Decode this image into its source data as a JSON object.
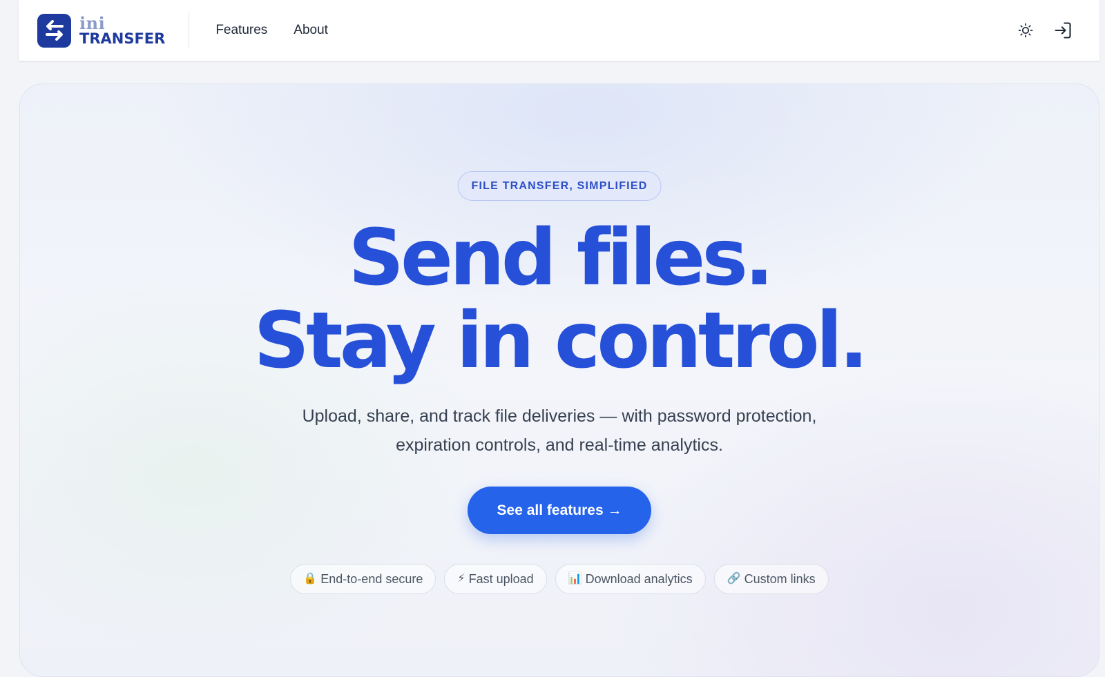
{
  "header": {
    "logo": {
      "line1": "ini",
      "line2": "TRANSFER"
    },
    "nav": [
      {
        "label": "Features"
      },
      {
        "label": "About"
      }
    ],
    "actions": {
      "theme_icon": "sun-icon",
      "login_icon": "sign-in-icon"
    }
  },
  "hero": {
    "eyebrow": "FILE TRANSFER, SIMPLIFIED",
    "headline_line1": "Send files.",
    "headline_line2": "Stay in control.",
    "subtitle": "Upload, share, and track file deliveries — with password protection, expiration controls, and real-time analytics.",
    "cta_label": "See all features →",
    "features": [
      {
        "icon": "🔒",
        "label": "End-to-end secure"
      },
      {
        "icon": "⚡",
        "label": "Fast upload"
      },
      {
        "icon": "📊",
        "label": "Download analytics"
      },
      {
        "icon": "🔗",
        "label": "Custom links"
      }
    ]
  },
  "colors": {
    "brand": "#1e3a9f",
    "accent": "#2563eb",
    "headline": "#2650d8"
  }
}
